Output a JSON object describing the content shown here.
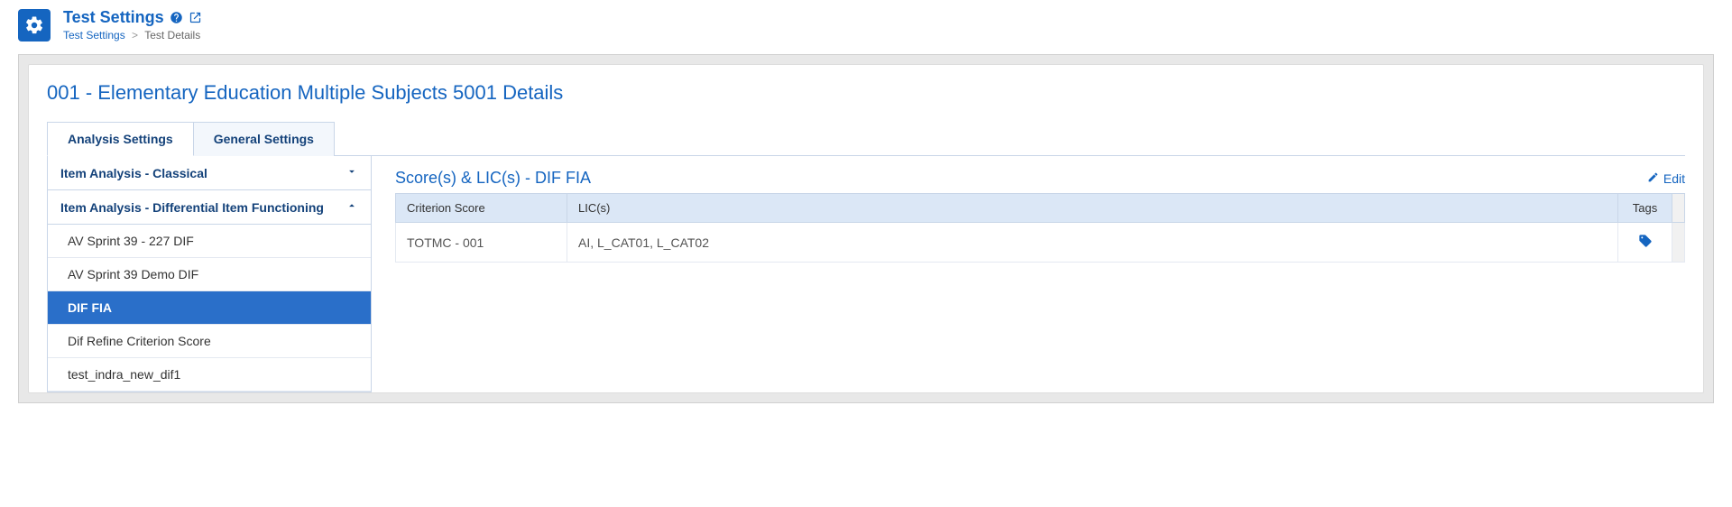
{
  "header": {
    "title": "Test Settings",
    "breadcrumb": {
      "root": "Test Settings",
      "current": "Test Details"
    }
  },
  "panel": {
    "title": "001 - Elementary Education Multiple Subjects 5001 Details"
  },
  "tabs": [
    {
      "label": "Analysis Settings",
      "active": true
    },
    {
      "label": "General Settings",
      "active": false
    }
  ],
  "accordion": [
    {
      "label": "Item Analysis - Classical",
      "expanded": false,
      "items": []
    },
    {
      "label": "Item Analysis - Differential Item Functioning",
      "expanded": true,
      "items": [
        {
          "label": "AV Sprint 39 - 227 DIF",
          "selected": false
        },
        {
          "label": "AV Sprint 39 Demo DIF",
          "selected": false
        },
        {
          "label": "DIF FIA",
          "selected": true
        },
        {
          "label": "Dif Refine Criterion Score",
          "selected": false
        },
        {
          "label": "test_indra_new_dif1",
          "selected": false
        }
      ]
    }
  ],
  "content": {
    "title": "Score(s) & LIC(s) - DIF FIA",
    "edit_label": "Edit",
    "columns": {
      "criterion": "Criterion Score",
      "lics": "LIC(s)",
      "tags": "Tags"
    },
    "rows": [
      {
        "criterion": "TOTMC - 001",
        "lics": "AI, L_CAT01, L_CAT02"
      }
    ]
  }
}
